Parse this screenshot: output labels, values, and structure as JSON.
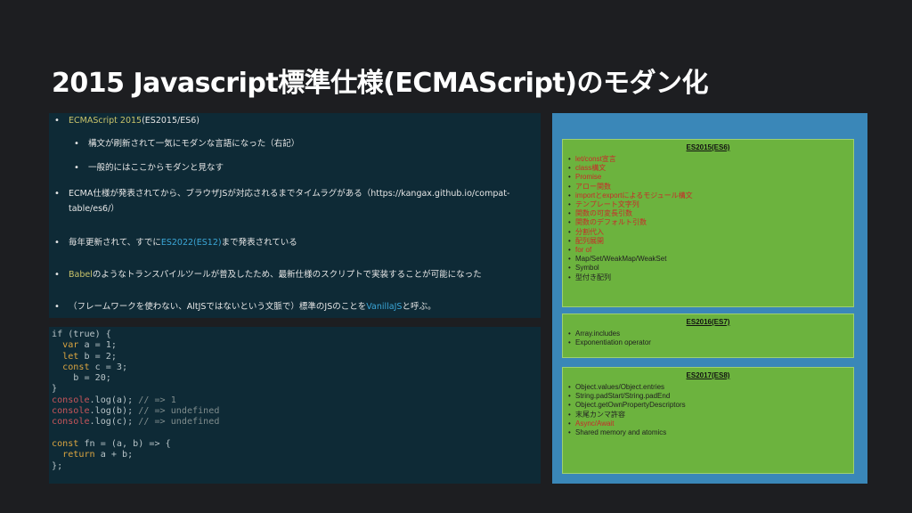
{
  "title": "2015 Javascript標準仕様(ECMAScript)のモダン化",
  "bullets": {
    "b1": {
      "hl": "ECMAScript 2015",
      "rest": "(ES2015/ES6)"
    },
    "b1a": "構文が刷新されて一気にモダンな言語になった（右記）",
    "b1b": "一般的にはここからモダンと見なす",
    "b2_line1": "ECMA仕様が発表されてから、ブラウザJSが対応されるまでタイムラグがある（https://kangax.github.io/compat-",
    "b2_line2": "table/es6/）",
    "b3": {
      "pre": "毎年更新されて、すでに",
      "hl": "ES2022(ES12)",
      "post": "まで発表されている"
    },
    "b4": {
      "hl": "Babel",
      "rest": "のようなトランスパイルツールが普及したため、最新仕様のスクリプトで実装することが可能になった"
    },
    "b5": {
      "pre": "（フレームワークを使わない、AltJSではないという文脈で）標準のJSのことを",
      "hl": "VanillaJS",
      "post": "と呼ぶ。"
    }
  },
  "code": {
    "l1": {
      "a": "if (true) {"
    },
    "l2": {
      "kw": "  var",
      "rest": " a = 1;"
    },
    "l3": {
      "kw": "  let",
      "rest": " b = 2;"
    },
    "l4": {
      "kw": "  const",
      "rest": " c = 3;"
    },
    "l5": {
      "rest": "    b = 20;"
    },
    "l6": {
      "rest": "}"
    },
    "l7": {
      "fn": "console",
      "rest": ".log(a); ",
      "cm": "// => 1"
    },
    "l8": {
      "fn": "console",
      "rest": ".log(b); ",
      "cm": "// => undefined"
    },
    "l9": {
      "fn": "console",
      "rest": ".log(c); ",
      "cm": "// => undefined"
    },
    "l11": {
      "kw": "const",
      "rest": " fn = (a, b) => {"
    },
    "l12": {
      "kw": "  return",
      "rest": " a + b;"
    },
    "l13": {
      "rest": "};"
    }
  },
  "es2015": {
    "heading": "ES2015(ES6)",
    "items": [
      "let/const宣言",
      "class構文",
      "Promise",
      "アロー関数",
      "importとexportによるモジュール構文",
      "テンプレート文字列",
      "関数の可変長引数",
      "関数のデフォルト引数",
      "分割代入",
      "配列展開",
      "for of",
      "Map/Set/WeakMap/WeakSet",
      "Symbol",
      "型付き配列"
    ]
  },
  "es2016": {
    "heading": "ES2016(ES7)",
    "items": [
      "Array.includes",
      "Exponentiation operator"
    ]
  },
  "es2017": {
    "heading": "ES2017(ES8)",
    "items": [
      "Object.values/Object.entries",
      "String.padStart/String.padEnd",
      "Object.getOwnPropertyDescriptors",
      "末尾カンマ許容",
      "Async/Await",
      "Shared memory and atomics"
    ]
  },
  "colors": {
    "highlight_red": "#c92a2a",
    "link_blue": "#3ba7d8",
    "panel_green": "#6cb33e"
  }
}
